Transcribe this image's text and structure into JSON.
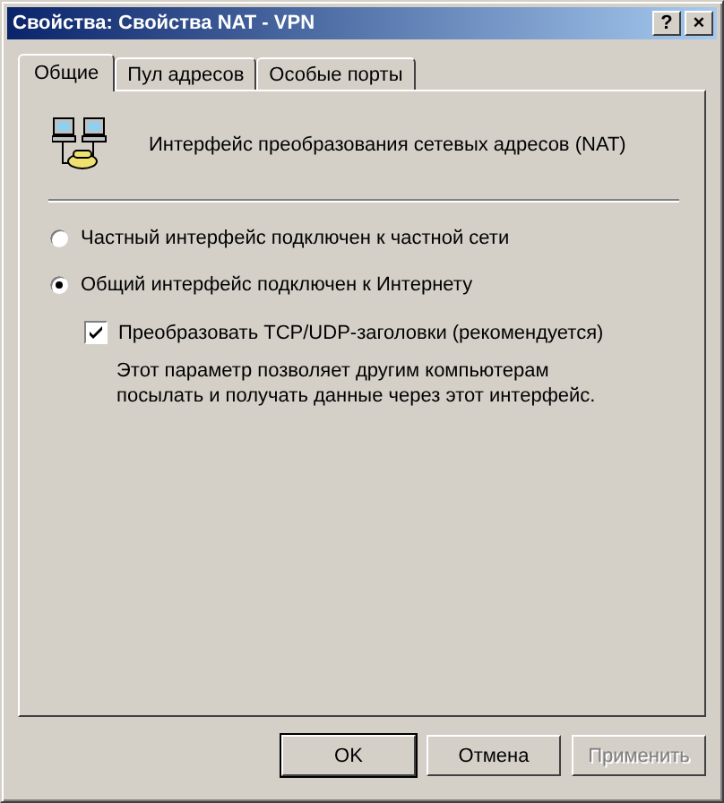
{
  "window": {
    "title": "Свойства: Свойства NAT - VPN",
    "help_button": "?",
    "close_button": "×"
  },
  "tabs": [
    {
      "label": "Общие",
      "selected": true
    },
    {
      "label": "Пул адресов",
      "selected": false
    },
    {
      "label": "Особые порты",
      "selected": false
    }
  ],
  "header": {
    "text": "Интерфейс преобразования сетевых адресов (NAT)"
  },
  "options": [
    {
      "kind": "radio",
      "label": "Частный интерфейс подключен к частной сети",
      "selected": false
    },
    {
      "kind": "radio",
      "label": "Общий интерфейс подключен к Интернету",
      "selected": true
    },
    {
      "kind": "checkbox",
      "label": "Преобразовать TCP/UDP-заголовки (рекомендуется)",
      "checked": true
    },
    {
      "kind": "note",
      "label": "Этот параметр позволяет другим компьютерам посылать и получать данные через этот интерфейс."
    }
  ],
  "buttons": [
    {
      "label": "OK",
      "default": true,
      "disabled": false
    },
    {
      "label": "Отмена",
      "default": false,
      "disabled": false
    },
    {
      "label": "Применить",
      "default": false,
      "disabled": true
    }
  ]
}
